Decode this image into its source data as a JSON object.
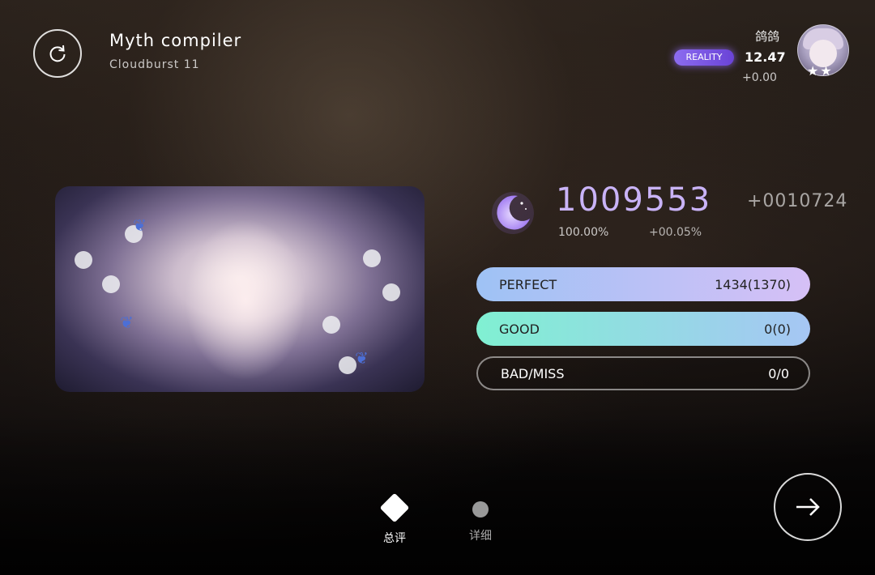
{
  "song": {
    "title": "Myth compiler",
    "level": "Cloudburst 11"
  },
  "player": {
    "name": "鸽鸽",
    "badge": "REALITY",
    "rating": "12.47",
    "rating_delta": "+0.00",
    "stars": "★★"
  },
  "score": {
    "value": "1009553",
    "delta": "+0010724",
    "accuracy": "100.00%",
    "accuracy_delta": "+00.05%"
  },
  "judgements": [
    {
      "label": "PERFECT",
      "value": "1434(1370)"
    },
    {
      "label": "GOOD",
      "value": "0(0)"
    },
    {
      "label": "BAD/MISS",
      "value": "0/0"
    }
  ],
  "tabs": [
    {
      "label": "总评",
      "active": true
    },
    {
      "label": "详细",
      "active": false
    }
  ],
  "icons": {
    "retry": "retry-icon",
    "next": "arrow-right-icon",
    "score": "moon-icon"
  },
  "colors": {
    "score": "#c9b3f7",
    "perfect_start": "#9ec2f5",
    "perfect_end": "#d6c0f6",
    "good_start": "#80f0d2",
    "good_end": "#a6c6f4",
    "badge": "#7a55e0"
  }
}
